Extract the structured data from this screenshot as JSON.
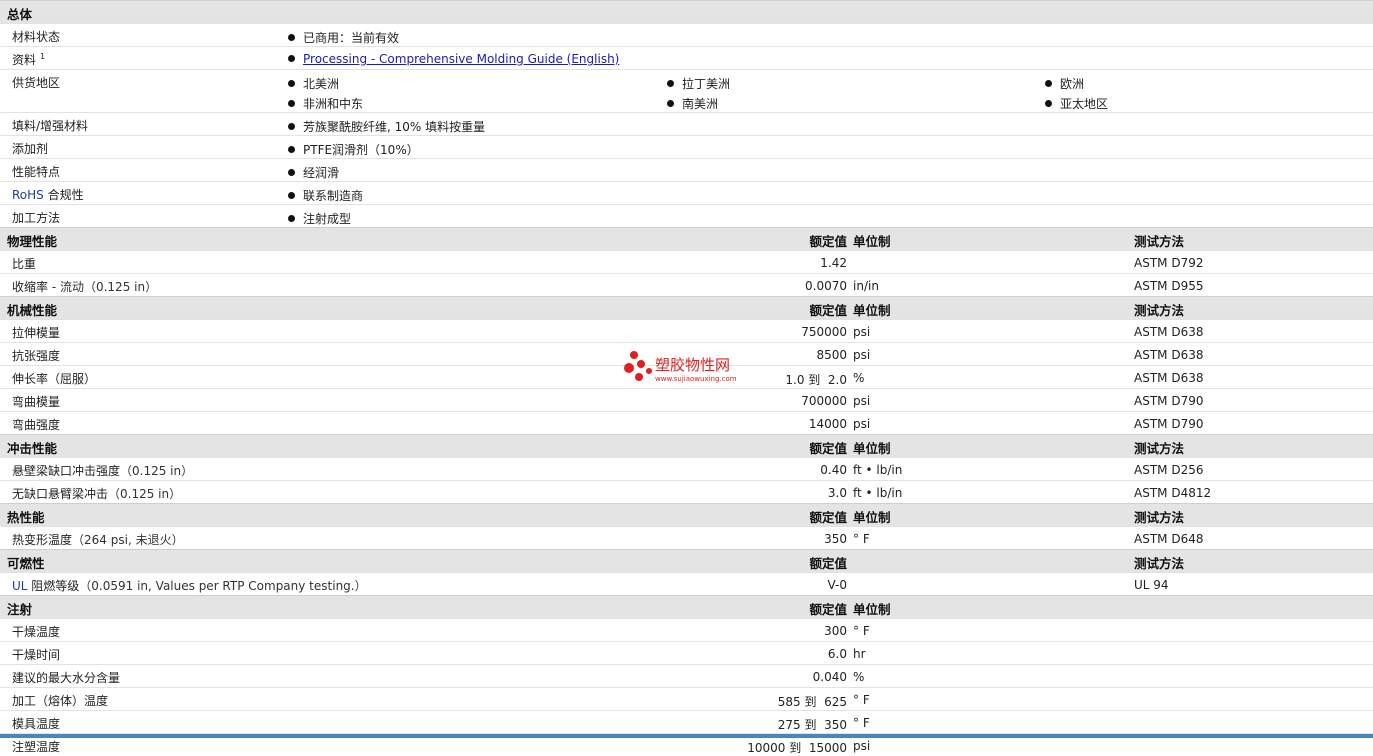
{
  "general": {
    "title": "总体",
    "rows": [
      {
        "label": "材料状态",
        "items": [
          "已商用：当前有效"
        ]
      },
      {
        "label": "资料",
        "sup": "1",
        "link": "Processing - Comprehensive Molding Guide (English)"
      },
      {
        "label": "供货地区",
        "regions": [
          "北美洲",
          "拉丁美洲",
          "欧洲",
          "非洲和中东",
          "南美洲",
          "亚太地区"
        ]
      },
      {
        "label": "填料/增强材料",
        "items": [
          "芳族聚酰胺纤维, 10% 填料按重量"
        ]
      },
      {
        "label": "添加剂",
        "items": [
          "PTFE润滑剂（10%）"
        ]
      },
      {
        "label": "性能特点",
        "items": [
          "经润滑"
        ]
      },
      {
        "label_accent": "RoHS",
        "label_rest": " 合规性",
        "items": [
          "联系制造商"
        ]
      },
      {
        "label": "加工方法",
        "items": [
          "注射成型"
        ]
      }
    ]
  },
  "headers": {
    "value": "额定值",
    "unit": "单位制",
    "method": "测试方法"
  },
  "sections": [
    {
      "title": "物理性能",
      "show_unit": true,
      "show_method": true,
      "rows": [
        {
          "label": "比重",
          "sub": "",
          "value": "1.42",
          "unit": "",
          "method": "ASTM D792"
        },
        {
          "label": "收缩率",
          "sub": " - 流动（0.125 in）",
          "value": "0.0070",
          "unit": "in/in",
          "method": "ASTM D955"
        }
      ]
    },
    {
      "title": "机械性能",
      "show_unit": true,
      "show_method": true,
      "rows": [
        {
          "label": "拉伸模量",
          "sub": "",
          "value": "750000",
          "unit": "psi",
          "method": "ASTM D638"
        },
        {
          "label": "抗张强度",
          "sub": "",
          "value": "8500",
          "unit": "psi",
          "method": "ASTM D638"
        },
        {
          "label": "伸长率（屈服）",
          "sub": "",
          "value": "1.0 到  2.0",
          "unit": "%",
          "method": "ASTM D638"
        },
        {
          "label": "弯曲模量",
          "sub": "",
          "value": "700000",
          "unit": "psi",
          "method": "ASTM D790"
        },
        {
          "label": "弯曲强度",
          "sub": "",
          "value": "14000",
          "unit": "psi",
          "method": "ASTM D790"
        }
      ]
    },
    {
      "title": "冲击性能",
      "show_unit": true,
      "show_method": true,
      "rows": [
        {
          "label": "悬壁梁缺口冲击强度",
          "sub": "（0.125 in）",
          "value": "0.40",
          "unit": "ft • lb/in",
          "method": "ASTM D256"
        },
        {
          "label": "无缺口悬臂梁冲击",
          "sub": "（0.125 in）",
          "value": "3.0",
          "unit": "ft • lb/in",
          "method": "ASTM D4812"
        }
      ]
    },
    {
      "title": "热性能",
      "show_unit": true,
      "show_method": true,
      "rows": [
        {
          "label": "热变形温度",
          "sub": "（264 psi, 未退火）",
          "value": "350",
          "unit": "° F",
          "method": "ASTM D648"
        }
      ]
    },
    {
      "title": "可燃性",
      "show_unit": false,
      "show_method": true,
      "rows": [
        {
          "label_accent": "UL",
          "label": " 阻燃等级",
          "sub": "（0.0591 in, Values per RTP Company testing.）",
          "value": "V-0",
          "unit": "",
          "method": "UL 94"
        }
      ]
    },
    {
      "title": "注射",
      "show_unit": true,
      "show_method": false,
      "rows": [
        {
          "label": "干燥温度",
          "sub": "",
          "value": "300",
          "unit": "° F",
          "method": ""
        },
        {
          "label": "干燥时间",
          "sub": "",
          "value": "6.0",
          "unit": "hr",
          "method": ""
        },
        {
          "label": "建议的最大水分含量",
          "sub": "",
          "value": "0.040",
          "unit": "%",
          "method": ""
        },
        {
          "label": "加工（熔体）温度",
          "sub": "",
          "value": "585 到  625",
          "unit": "° F",
          "method": ""
        },
        {
          "label": "模具温度",
          "sub": "",
          "value": "275 到  350",
          "unit": "° F",
          "method": ""
        },
        {
          "label": "注塑温度",
          "sub": "",
          "value": "10000 到  15000",
          "unit": "psi",
          "method": ""
        }
      ]
    }
  ],
  "watermark": {
    "name": "塑胶物性网",
    "url": "www.sujiaowuxing.com",
    "color": "#e02020"
  }
}
